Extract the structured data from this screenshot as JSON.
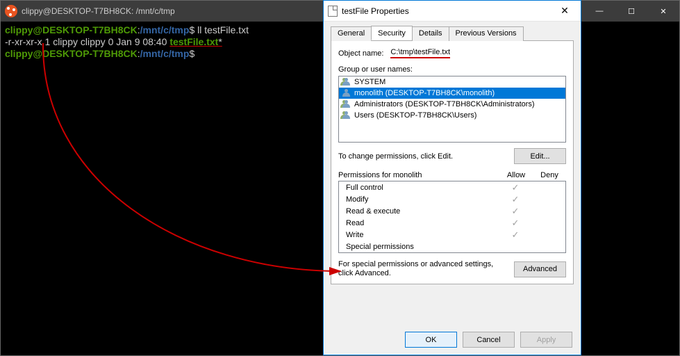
{
  "terminal": {
    "title": "clippy@DESKTOP-T7BH8CK: /mnt/c/tmp",
    "prompt_user": "clippy@DESKTOP-T7BH8CK",
    "prompt_sep": ":",
    "prompt_path": "/mnt/c/tmp",
    "prompt_dollar": "$",
    "cmd1": "ll testFile.txt",
    "ls_perm": "-r-xr-xr-x 1 clippy clippy 0 Jan  9 08:40 ",
    "ls_file": "testFile.txt",
    "ls_star": "*",
    "win_min": "—",
    "win_max": "☐",
    "win_close": "✕"
  },
  "bgwin": {
    "min": "—",
    "max": "☐",
    "close": "✕"
  },
  "dlg": {
    "title": "testFile Properties",
    "close": "✕",
    "tabs": {
      "general": "General",
      "security": "Security",
      "details": "Details",
      "prev": "Previous Versions"
    },
    "object_name_label": "Object name:",
    "object_name": "C:\\tmp\\testFile.txt",
    "group_label": "Group or user names:",
    "users": [
      {
        "icon": "group-icon",
        "label": "SYSTEM"
      },
      {
        "icon": "user-icon",
        "label": "monolith (DESKTOP-T7BH8CK\\monolith)"
      },
      {
        "icon": "group-icon",
        "label": "Administrators (DESKTOP-T7BH8CK\\Administrators)"
      },
      {
        "icon": "group-icon",
        "label": "Users (DESKTOP-T7BH8CK\\Users)"
      }
    ],
    "selected_user_index": 1,
    "change_hint": "To change permissions, click Edit.",
    "edit_btn": "Edit...",
    "perm_for_label": "Permissions for monolith",
    "col_allow": "Allow",
    "col_deny": "Deny",
    "permissions": [
      {
        "name": "Full control",
        "allow": true,
        "deny": false
      },
      {
        "name": "Modify",
        "allow": true,
        "deny": false
      },
      {
        "name": "Read & execute",
        "allow": true,
        "deny": false
      },
      {
        "name": "Read",
        "allow": true,
        "deny": false
      },
      {
        "name": "Write",
        "allow": true,
        "deny": false
      },
      {
        "name": "Special permissions",
        "allow": false,
        "deny": false
      }
    ],
    "adv_hint": "For special permissions or advanced settings, click Advanced.",
    "adv_btn": "Advanced",
    "ok": "OK",
    "cancel": "Cancel",
    "apply": "Apply"
  },
  "colors": {
    "accent": "#0078d7",
    "ubuntu": "#e95420",
    "term_green": "#4e9a06",
    "term_blue": "#3465a4",
    "annotation_red": "#c00"
  }
}
